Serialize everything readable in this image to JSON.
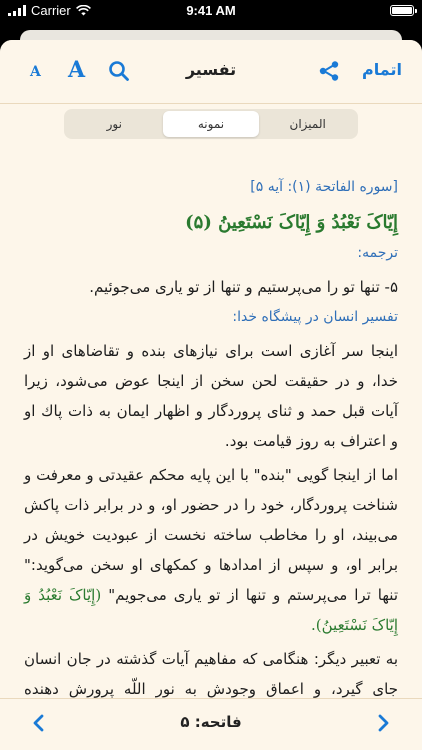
{
  "status": {
    "carrier": "Carrier",
    "time": "9:41 AM"
  },
  "nav": {
    "title": "تفسیر",
    "done_label": "اتمام",
    "font_small_label": "A",
    "font_large_label": "A"
  },
  "tabs": [
    {
      "label": "المیزان"
    },
    {
      "label": "نمونه"
    },
    {
      "label": "نور"
    }
  ],
  "content": {
    "reference": "[سوره الفاتحة (۱): آیه ۵]",
    "verse": "إِیّاکَ نَعْبُدُ وَ إِیّاکَ نَسْتَعِینُ (۵)",
    "translation_heading": "ترجمه:",
    "translation": "۵- تنها تو را می‌پرستیم و تنها از تو یاری می‌جوئیم.",
    "section_heading": "تفسیر انسان در پیشگاه خدا:",
    "paragraph1": "اینجا سر آغازی است برای نیازهای بنده و تقاضاهای او از خدا، و در حقیقت لحن سخن از اینجا عوض می‌شود، زیرا آیات قبل حمد و ثنای پروردگار و اظهار ایمان به ذات پاك او و اعتراف به روز قیامت بود.",
    "paragraph2_text": "اما از اینجا گویی \"بنده\" با این پایه محکم عقیدتی و معرفت و شناخت پروردگار، خود را در حضور او، و در برابر ذات پاکش می‌بیند، او را مخاطب ساخته نخست از عبودیت خویش در برابر او، و سپس از امدادها و کمکهای او سخن می‌گوید:\" تنها ترا می‌پرستم و تنها از تو یاری می‌جویم\"",
    "paragraph2_verse": "(إِیّاکَ نَعْبُدُ وَ إِیّاکَ نَسْتَعِینُ).",
    "paragraph3": "به تعبیر دیگر: هنگامی که مفاهیم آیات گذشته در جان انسان جای گیرد، و اعماق وجودش به نور اللّه پرورش دهنده جهانیان"
  },
  "footer": {
    "label": "فاتحه: ۵"
  },
  "colors": {
    "accent": "#1a7ad6",
    "background": "#fdf6ea",
    "verse": "#2a7a2f",
    "heading": "#2f6fb8"
  }
}
